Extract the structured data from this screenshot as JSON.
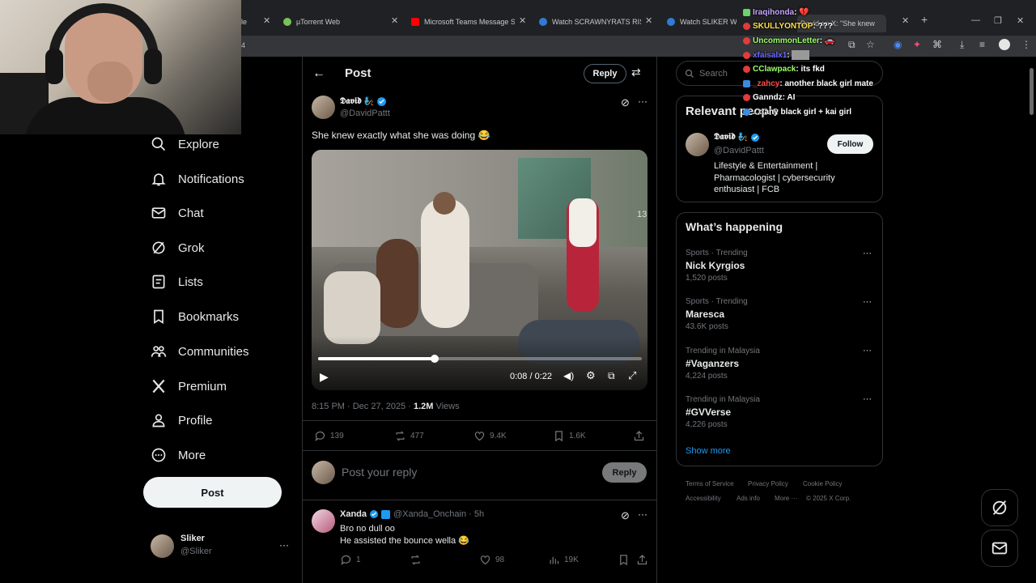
{
  "browser": {
    "tabs": [
      {
        "label": "le"
      },
      {
        "label": "µTorrent Web"
      },
      {
        "label": "Microsoft Teams Message Sou"
      },
      {
        "label": "Watch SCRAWNYRATS RISE | Sl"
      },
      {
        "label": "Watch SLIKER WILL YOU BE R"
      },
      {
        "label": "David on X: \"She knew"
      }
    ],
    "address_fragment": "4"
  },
  "nav": {
    "items": [
      {
        "label": "Explore",
        "icon": "search-icon"
      },
      {
        "label": "Notifications",
        "icon": "bell-icon"
      },
      {
        "label": "Chat",
        "icon": "mail-icon"
      },
      {
        "label": "Grok",
        "icon": "grok-icon"
      },
      {
        "label": "Lists",
        "icon": "list-icon"
      },
      {
        "label": "Bookmarks",
        "icon": "bookmark-icon"
      },
      {
        "label": "Communities",
        "icon": "people-icon"
      },
      {
        "label": "Premium",
        "icon": "x-logo-icon"
      },
      {
        "label": "Profile",
        "icon": "person-icon"
      },
      {
        "label": "More",
        "icon": "more-circle-icon"
      }
    ],
    "post_label": "Post",
    "account": {
      "name": "Sliker",
      "handle": "@Sliker"
    }
  },
  "post_header": {
    "title": "Post",
    "reply_label": "Reply"
  },
  "post": {
    "author_name": "𝕯𝖆𝖛𝖎𝖉",
    "author_emoji": "🧞",
    "handle": "@DavidPattt",
    "text": "She knew exactly what she was doing 😂",
    "video": {
      "time": "0:08 / 0:22",
      "progress": 0.36,
      "watermark": "13"
    },
    "meta": {
      "time": "8:15 PM · Dec 27, 2025 · ",
      "views_count": "1.2M",
      "views_label": " Views"
    },
    "stats": {
      "replies": "139",
      "reposts": "477",
      "likes": "9.4K",
      "bookmarks": "1.6K"
    }
  },
  "compose": {
    "placeholder": "Post your reply",
    "reply_label": "Reply"
  },
  "reply": {
    "name": "Xanda",
    "handle": "@Xanda_Onchain · 5h",
    "line1": "Bro no dull oo",
    "line2": "He assisted the bounce wella 😂",
    "stats": {
      "replies": "1",
      "likes": "98",
      "views": "19K"
    }
  },
  "right": {
    "search_placeholder": "Search",
    "relevant_title": "Relevant people",
    "person": {
      "name": "𝕯𝖆𝖛𝖎𝖉",
      "emoji": "🧞",
      "handle": "@DavidPattt",
      "follow_label": "Follow",
      "bio": "Lifestyle & Entertainment | Pharmacologist | cybersecurity enthusiast | FCB"
    },
    "happening_title": "What’s happening",
    "trends": [
      {
        "category": "Sports · Trending",
        "name": "Nick Kyrgios",
        "count": "1,520 posts"
      },
      {
        "category": "Sports · Trending",
        "name": "Maresca",
        "count": "43.6K posts"
      },
      {
        "category": "Trending in Malaysia",
        "name": "#Vaganzers",
        "count": "4,224 posts"
      },
      {
        "category": "Trending in Malaysia",
        "name": "#GVVerse",
        "count": "4,226 posts"
      }
    ],
    "show_more": "Show more",
    "footer": [
      "Terms of Service",
      "Privacy Policy",
      "Cookie Policy",
      "Accessibility",
      "Ads info",
      "More ···",
      "© 2025 X Corp."
    ]
  },
  "chat": [
    {
      "user": "Iraqihonda",
      "text": " : 💔",
      "color": "#c9a7ff"
    },
    {
      "user": "SKULLYONTOP",
      "text": " : ???",
      "color": "#ffe04a"
    },
    {
      "user": "UncommonLetter",
      "text": " : 🚗",
      "color": "#9dff6b"
    },
    {
      "user": "xfaisalx1",
      "text": " : ",
      "color": "#6a6aff"
    },
    {
      "user": "CClawpack",
      "text": " : its fkd",
      "color": "#9dff6b"
    },
    {
      "user": "_zahcy",
      "text": " : another black girl mate",
      "color": "#ff4a4a"
    },
    {
      "user": "Ganndz",
      "text": " : AI",
      "color": "#ffffff"
    },
    {
      "user": "...",
      "text": " : any black girl + kai girl",
      "color": "#ffffff"
    }
  ],
  "colors": {
    "accent": "#1d9bf0",
    "verified": "#1d9bf0",
    "bg": "#000000",
    "border": "#2f3336"
  }
}
